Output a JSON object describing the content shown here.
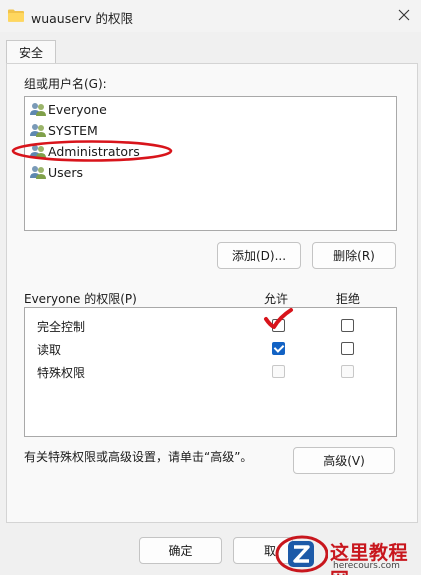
{
  "window": {
    "title": "wuauserv 的权限"
  },
  "tabs": [
    {
      "label": "安全"
    }
  ],
  "groups": {
    "label": "组或用户名(G):",
    "items": [
      {
        "label": "Everyone"
      },
      {
        "label": "SYSTEM"
      },
      {
        "label": "Administrators"
      },
      {
        "label": "Users"
      }
    ],
    "add_button": "添加(D)...",
    "remove_button": "删除(R)"
  },
  "permissions": {
    "title": "Everyone 的权限(P)",
    "allow_header": "允许",
    "deny_header": "拒绝",
    "rows": [
      {
        "name": "完全控制",
        "allow": true,
        "deny": false
      },
      {
        "name": "读取",
        "allow": true,
        "deny": false
      },
      {
        "name": "特殊权限",
        "allow": false,
        "deny": false
      }
    ]
  },
  "advanced": {
    "note": "有关特殊权限或高级设置，请单击“高级”。",
    "button": "高级(V)"
  },
  "footer": {
    "ok": "确定",
    "cancel": "取"
  },
  "watermark": {
    "title": "这里教程网",
    "url": "herecours.com"
  },
  "colors": {
    "annotation": "#d8141b",
    "checkbox_accent": "#1262c4"
  }
}
